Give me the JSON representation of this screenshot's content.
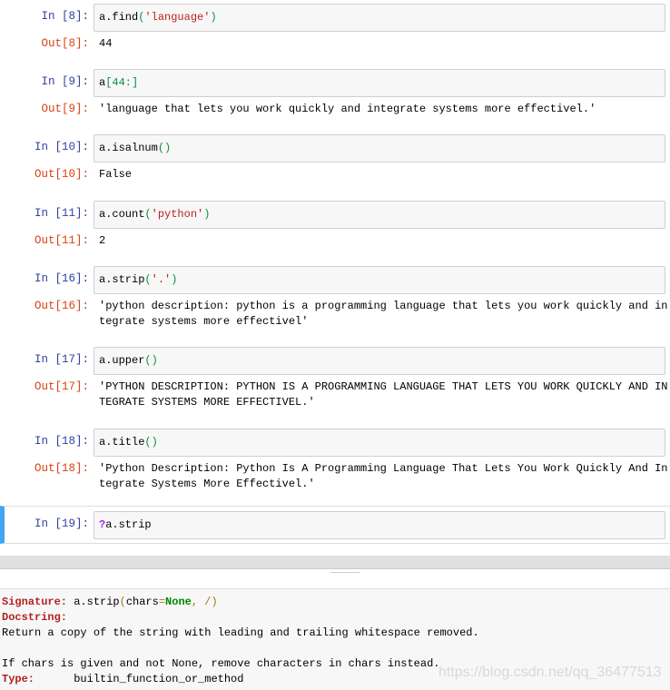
{
  "cells": [
    {
      "in": "In  [8]:",
      "code": [
        [
          "a.find",
          ""
        ],
        [
          "(",
          "p"
        ],
        [
          "'language'",
          "s"
        ],
        [
          ")",
          "p"
        ]
      ],
      "out_prompt": "Out[8]:",
      "out": [
        "44"
      ]
    },
    {
      "in": "In  [9]:",
      "code": [
        [
          "a",
          ""
        ],
        [
          "[44:]",
          "p"
        ]
      ],
      "out_prompt": "Out[9]:",
      "out": [
        "'language that lets you work quickly and integrate systems more effectivel.'"
      ]
    },
    {
      "in": "In  [10]:",
      "code": [
        [
          "a.isalnum",
          ""
        ],
        [
          "()",
          "p"
        ]
      ],
      "out_prompt": "Out[10]:",
      "out": [
        "False"
      ]
    },
    {
      "in": "In  [11]:",
      "code": [
        [
          "a.count",
          ""
        ],
        [
          "(",
          "p"
        ],
        [
          "'python'",
          "s"
        ],
        [
          ")",
          "p"
        ]
      ],
      "out_prompt": "Out[11]:",
      "out": [
        "2"
      ]
    },
    {
      "in": "In  [16]:",
      "code": [
        [
          "a.strip",
          ""
        ],
        [
          "(",
          "p"
        ],
        [
          "'.'",
          "s"
        ],
        [
          ")",
          "p"
        ]
      ],
      "out_prompt": "Out[16]:",
      "out": [
        "'python description: python is a programming language that lets you work quickly and in",
        "tegrate systems more effectivel'"
      ]
    },
    {
      "in": "In  [17]:",
      "code": [
        [
          "a.upper",
          ""
        ],
        [
          "()",
          "p"
        ]
      ],
      "out_prompt": "Out[17]:",
      "out": [
        "'PYTHON DESCRIPTION: PYTHON IS A PROGRAMMING LANGUAGE THAT LETS YOU WORK QUICKLY AND IN",
        "TEGRATE SYSTEMS MORE EFFECTIVEL.'"
      ]
    },
    {
      "in": "In  [18]:",
      "code": [
        [
          "a.title",
          ""
        ],
        [
          "()",
          "p"
        ]
      ],
      "out_prompt": "Out[18]:",
      "out": [
        "'Python Description: Python Is A Programming Language That Lets You Work Quickly And In",
        "tegrate Systems More Effectivel.'"
      ]
    },
    {
      "in": "In  [19]:",
      "code": [
        [
          "?",
          "q"
        ],
        [
          "a.strip",
          ""
        ]
      ],
      "selected": true
    }
  ],
  "pager": {
    "signature_label": "Signature:",
    "signature_pre": " a.strip",
    "signature_open": "(",
    "signature_arg": "chars",
    "signature_eq": "=",
    "signature_none": "None",
    "signature_close": ", /)",
    "docstring_label": "Docstring:",
    "doc_line1": "Return a copy of the string with leading and trailing whitespace removed.",
    "doc_line2": "If chars is given and not None, remove characters in chars instead.",
    "type_label": "Type:",
    "type_value": "      builtin_function_or_method"
  },
  "watermark": "https://blog.csdn.net/qq_36477513"
}
